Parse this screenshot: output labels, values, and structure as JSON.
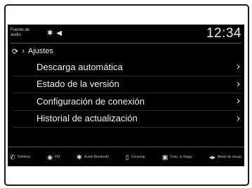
{
  "status": {
    "source_label": "Fuente de audio",
    "time": "12:34",
    "icons": [
      "bluetooth-icon",
      "speaker-icon"
    ]
  },
  "breadcrumb": {
    "title": "Ajustes",
    "icons": [
      "refresh-icon",
      "chevron-right-icon"
    ]
  },
  "menu": {
    "items": [
      {
        "label": "Descarga automática",
        "chevron": "›"
      },
      {
        "label": "Estado de la versión",
        "chevron": "›"
      },
      {
        "label": "Configuración de conexión",
        "chevron": "›"
      },
      {
        "label": "Historial de actualización",
        "chevron": "›"
      }
    ]
  },
  "bottombar": {
    "items": [
      {
        "label": "Teléfono",
        "icon": "phone-icon"
      },
      {
        "label": "FM",
        "icon": "radio-icon"
      },
      {
        "label": "Audio Bluetooth",
        "icon": "bluetooth-audio-icon"
      },
      {
        "label": "Conectar",
        "icon": "smartphone-icon"
      },
      {
        "label": "Cmp. in Stage",
        "icon": "stage-icon"
      },
      {
        "label": "Modo de visual.",
        "icon": "display-mode-icon"
      }
    ]
  }
}
